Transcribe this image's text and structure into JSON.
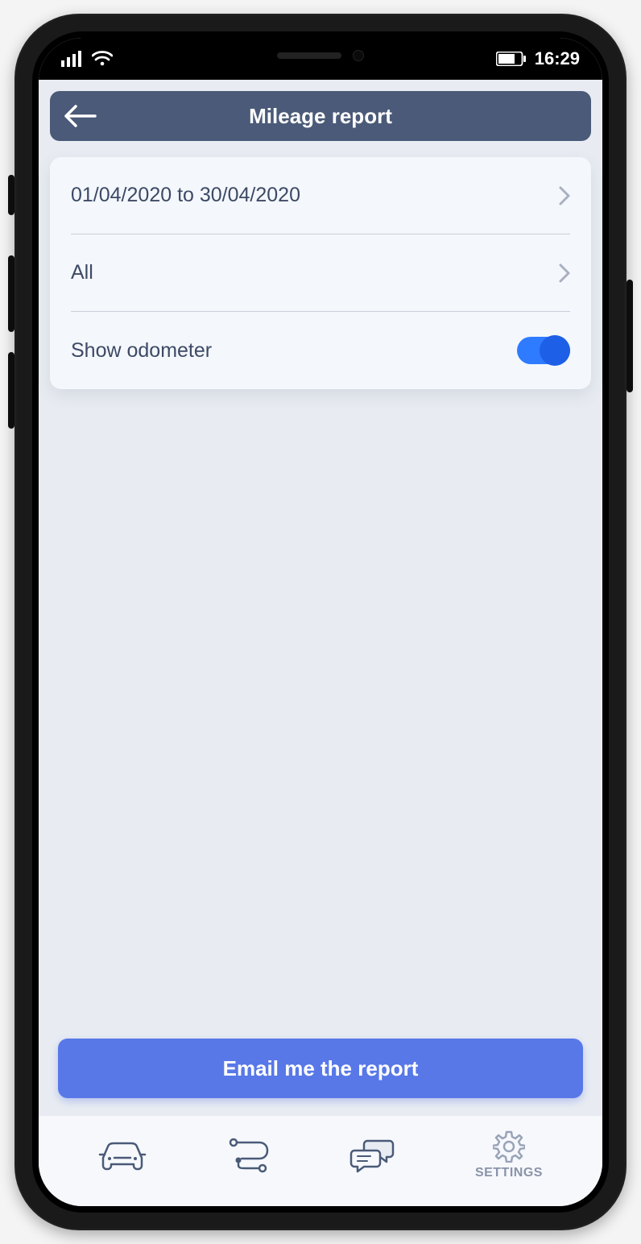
{
  "status": {
    "time": "16:29"
  },
  "header": {
    "title": "Mileage report"
  },
  "report": {
    "date_range": "01/04/2020 to 30/04/2020",
    "filter": "All",
    "odometer_label": "Show odometer",
    "odometer_on": true
  },
  "action": {
    "email_label": "Email me the report"
  },
  "tabs": {
    "settings_label": "SETTINGS"
  }
}
